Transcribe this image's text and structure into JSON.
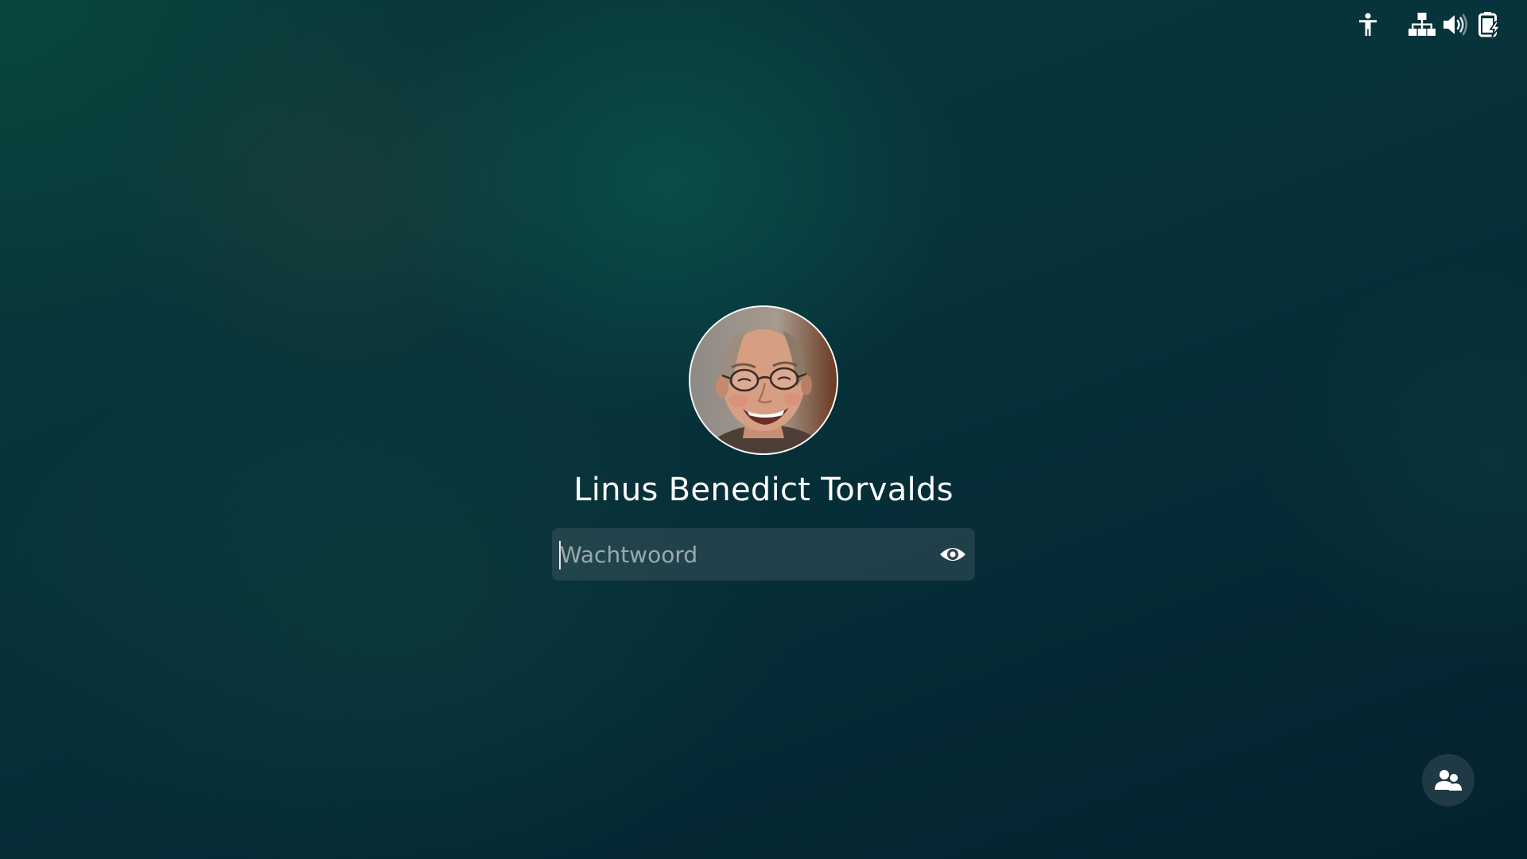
{
  "top_bar": {
    "icons": {
      "accessibility": "accessibility-icon",
      "network": "network-wired-icon",
      "volume": "volume-high-icon",
      "battery": "battery-charging-icon"
    }
  },
  "login": {
    "user_name": "Linus Benedict Torvalds",
    "password": {
      "placeholder": "Wachtwoord",
      "value": "",
      "reveal_icon": "eye-icon"
    },
    "avatar": "user-avatar-photo"
  },
  "bottom": {
    "switch_user_icon": "users-icon"
  },
  "colors": {
    "background_dark": "#04222e",
    "background_teal": "#083a3a",
    "field_bg": "rgba(70,90,100,0.42)",
    "text": "#ffffff"
  }
}
